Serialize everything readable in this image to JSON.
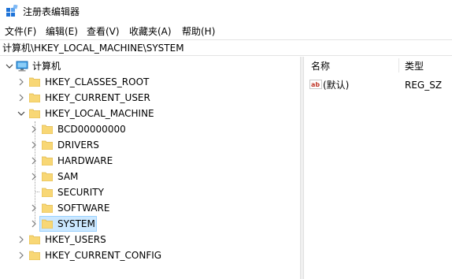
{
  "window": {
    "title": "注册表编辑器",
    "icon": "registry-editor-icon"
  },
  "menu": [
    {
      "label": "文件(F)"
    },
    {
      "label": "编辑(E)"
    },
    {
      "label": "查看(V)"
    },
    {
      "label": "收藏夹(A)"
    },
    {
      "label": "帮助(H)"
    }
  ],
  "address": {
    "path": "计算机\\HKEY_LOCAL_MACHINE\\SYSTEM"
  },
  "tree": {
    "root": {
      "label": "计算机",
      "icon": "computer-icon",
      "expanded": true
    },
    "hives": [
      {
        "label": "HKEY_CLASSES_ROOT",
        "expanded": false
      },
      {
        "label": "HKEY_CURRENT_USER",
        "expanded": false
      },
      {
        "label": "HKEY_LOCAL_MACHINE",
        "expanded": true
      },
      {
        "label": "HKEY_USERS",
        "expanded": false
      },
      {
        "label": "HKEY_CURRENT_CONFIG",
        "expanded": false
      }
    ],
    "hklm_children": [
      {
        "label": "BCD00000000",
        "has_children": true
      },
      {
        "label": "DRIVERS",
        "has_children": true
      },
      {
        "label": "HARDWARE",
        "has_children": true
      },
      {
        "label": "SAM",
        "has_children": true
      },
      {
        "label": "SECURITY",
        "has_children": false
      },
      {
        "label": "SOFTWARE",
        "has_children": true
      },
      {
        "label": "SYSTEM",
        "has_children": true,
        "selected": true
      }
    ]
  },
  "list": {
    "columns": [
      {
        "label": "名称"
      },
      {
        "label": "类型"
      }
    ],
    "rows": [
      {
        "icon": "string-value-icon",
        "name": "(默认)",
        "type": "REG_SZ"
      }
    ]
  },
  "colors": {
    "selection": "#cce8ff",
    "selection_border": "#99d1ff",
    "folder": "#f8d775",
    "folder_dark": "#e0b84a"
  }
}
